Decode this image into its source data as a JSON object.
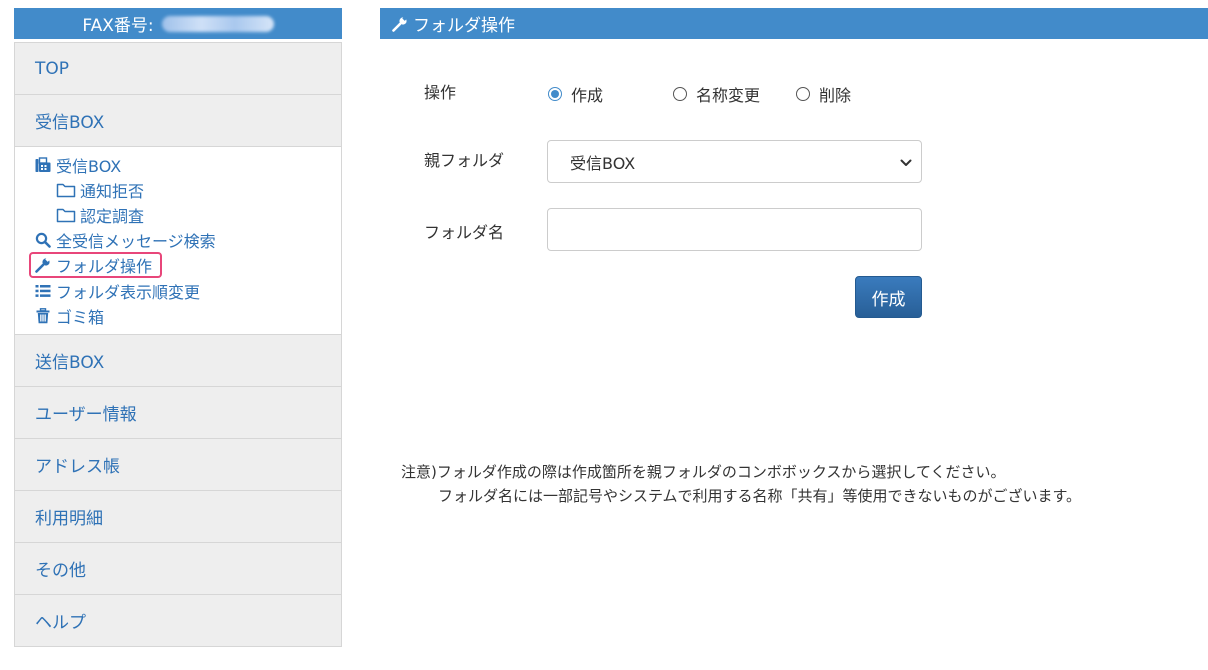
{
  "sidebar": {
    "fax_label": "FAX番号:",
    "menu_top": "TOP",
    "menu_inbox": "受信BOX",
    "submenu": {
      "inbox": "受信BOX",
      "reject": "通知拒否",
      "verify": "認定調査",
      "search_all": "全受信メッセージ検索",
      "folder_ops": "フォルダ操作",
      "folder_order": "フォルダ表示順変更",
      "trash": "ゴミ箱"
    },
    "menu_outbox": "送信BOX",
    "menu_user": "ユーザー情報",
    "menu_address": "アドレス帳",
    "menu_usage": "利用明細",
    "menu_other": "その他",
    "menu_help": "ヘルプ"
  },
  "main": {
    "title": "フォルダ操作",
    "operation_label": "操作",
    "radios": {
      "create": "作成",
      "rename": "名称変更",
      "delete": "削除",
      "selected": "create"
    },
    "parent_label": "親フォルダ",
    "parent_value": "受信BOX",
    "name_label": "フォルダ名",
    "name_value": "",
    "submit_label": "作成",
    "note_line1": "注意)フォルダ作成の際は作成箇所を親フォルダのコンボボックスから選択してください。",
    "note_line2": "フォルダ名には一部記号やシステムで利用する名称「共有」等使用できないものがございます。"
  },
  "colors": {
    "header_blue": "#428bca",
    "link_blue": "#2f72b6",
    "highlight_pink": "#e8467a",
    "button_blue": "#2e6aa8"
  }
}
